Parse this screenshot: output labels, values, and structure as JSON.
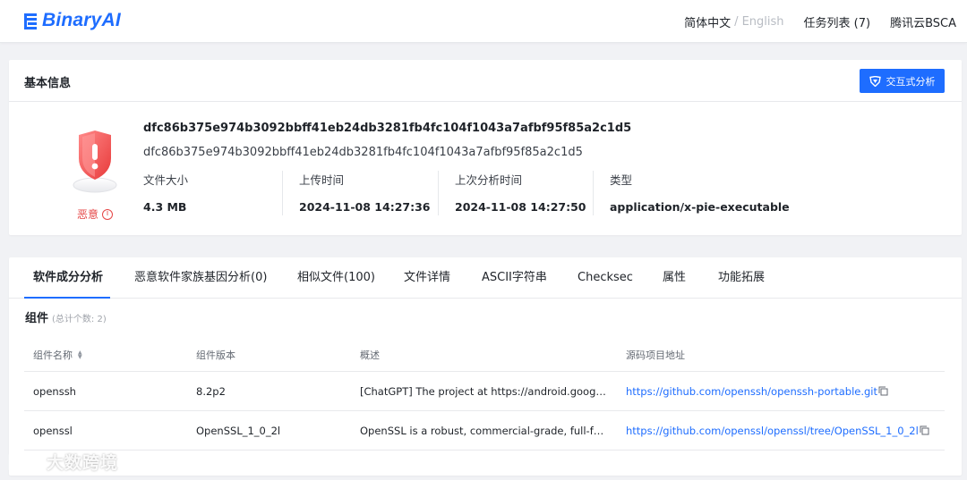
{
  "header": {
    "logo_text": "BinaryAI",
    "lang_zh": "简体中文",
    "lang_sep": "/",
    "lang_en": "English",
    "task_list": "任务列表 (7)",
    "tencent_bsca": "腾讯云BSCA"
  },
  "basic_info": {
    "title": "基本信息",
    "interactive_button": "交互式分析",
    "threat_label": "恶意",
    "threat_info_glyph": "i",
    "hash_primary": "dfc86b375e974b3092bbff41eb24db3281fb4fc104f1043a7afbf95f85a2c1d5",
    "hash_secondary": "dfc86b375e974b3092bbff41eb24db3281fb4fc104f1043a7afbf95f85a2c1d5",
    "meta": [
      {
        "label": "文件大小",
        "value": "4.3 MB"
      },
      {
        "label": "上传时间",
        "value": "2024-11-08 14:27:36"
      },
      {
        "label": "上次分析时间",
        "value": "2024-11-08 14:27:50"
      },
      {
        "label": "类型",
        "value": "application/x-pie-executable"
      }
    ]
  },
  "tabs": [
    {
      "label": "软件成分分析"
    },
    {
      "label": "恶意软件家族基因分析(0)"
    },
    {
      "label": "相似文件(100)"
    },
    {
      "label": "文件详情"
    },
    {
      "label": "ASCII字符串"
    },
    {
      "label": "Checksec"
    },
    {
      "label": "属性"
    },
    {
      "label": "功能拓展"
    }
  ],
  "components": {
    "title": "组件",
    "count_text": "(总计个数: 2)",
    "headers": [
      "组件名称",
      "组件版本",
      "概述",
      "源码项目地址"
    ],
    "rows": [
      {
        "name": "openssh",
        "version": "8.2p2",
        "summary": "[ChatGPT] The project at https://android.googlesource.com/platform/external/openssh",
        "url": "https://github.com/openssh/openssh-portable.git"
      },
      {
        "name": "openssl",
        "version": "OpenSSL_1_0_2l",
        "summary": "OpenSSL is a robust, commercial-grade, full-featured toolkit for TLS and SSL",
        "url": "https://github.com/openssl/openssl/tree/OpenSSL_1_0_2l"
      }
    ]
  },
  "watermark": {
    "text": "大数跨境"
  },
  "colors": {
    "accent": "#1e6dff",
    "malicious": "#e54545"
  }
}
